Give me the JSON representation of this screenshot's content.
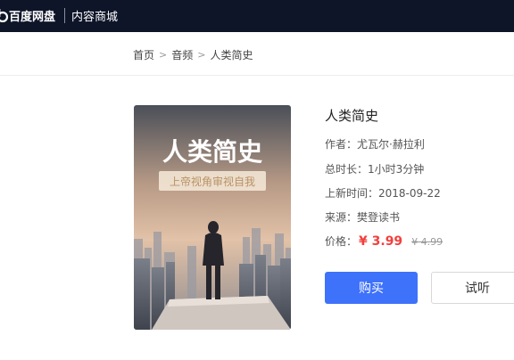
{
  "topbar": {
    "brand_name": "百度网盘",
    "section_name": "内容商城",
    "logo_icon": "baidu-netdisk-logo-icon"
  },
  "breadcrumb": {
    "items": [
      "首页",
      "音频",
      "人类简史"
    ],
    "separator": ">"
  },
  "book": {
    "title": "人类简史",
    "cover_title": "人类简史",
    "cover_subtitle": "上帝视角审视自我",
    "author_label": "作者：",
    "author": "尤瓦尔·赫拉利",
    "duration_label": "总时长：",
    "duration": "1小时3分钟",
    "updated_label": "上新时间：",
    "updated": "2018-09-22",
    "source_label": "来源：",
    "source": "樊登读书",
    "price_label": "价格：",
    "price": "¥ 3.99",
    "original_price": "¥ 4.99"
  },
  "actions": {
    "buy_label": "购买",
    "try_label": "试听"
  },
  "colors": {
    "topbar": "#0f1529",
    "accent": "#3f72fb",
    "price": "#f2403d"
  }
}
